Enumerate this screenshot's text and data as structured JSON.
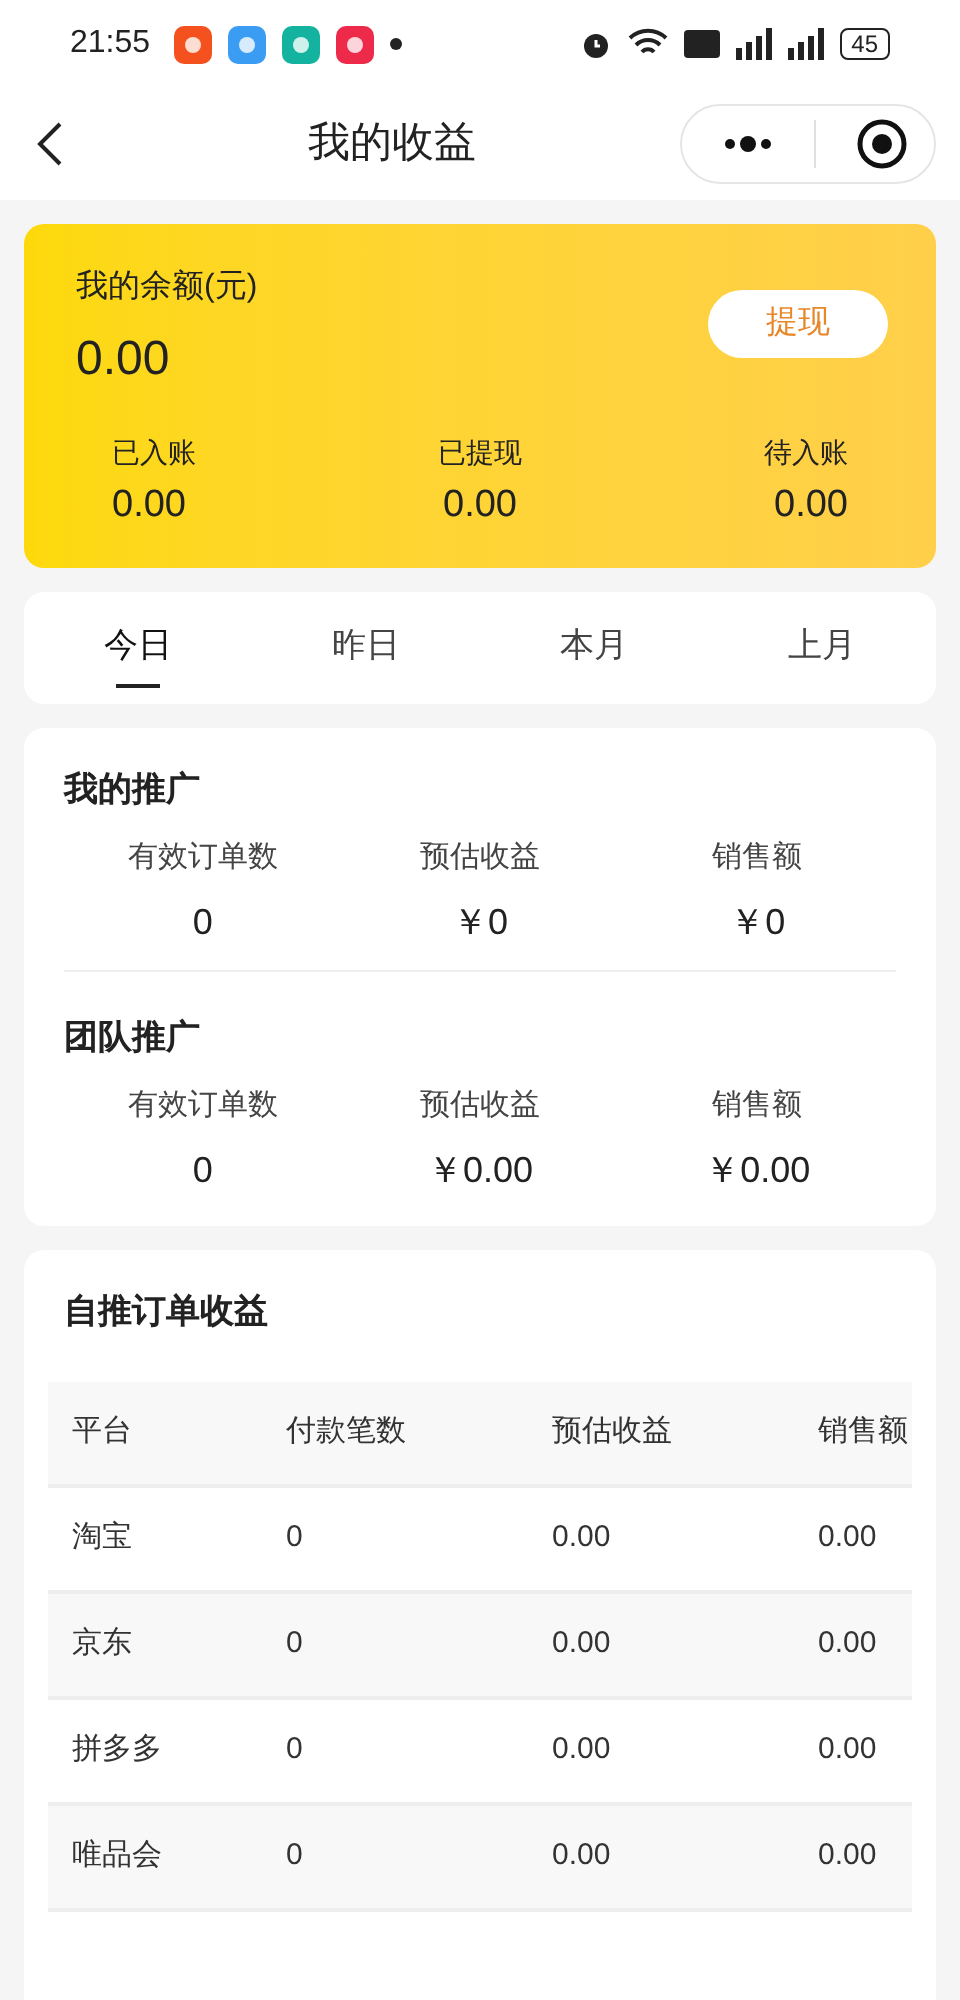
{
  "status_bar": {
    "time": "21:55",
    "battery": "45"
  },
  "header": {
    "title": "我的收益"
  },
  "balance": {
    "label": "我的余额(元)",
    "amount": "0.00",
    "withdraw_button": "提现",
    "stats": [
      {
        "label": "已入账",
        "value": "0.00"
      },
      {
        "label": "已提现",
        "value": "0.00"
      },
      {
        "label": "待入账",
        "value": "0.00"
      }
    ]
  },
  "tabs": [
    {
      "label": "今日",
      "selected": true
    },
    {
      "label": "昨日",
      "selected": false
    },
    {
      "label": "本月",
      "selected": false
    },
    {
      "label": "上月",
      "selected": false
    }
  ],
  "sections": [
    {
      "title": "我的推广",
      "stats": [
        {
          "label": "有效订单数",
          "value": "0"
        },
        {
          "label": "预估收益",
          "value": "￥0"
        },
        {
          "label": "销售额",
          "value": "￥0"
        }
      ]
    },
    {
      "title": "团队推广",
      "stats": [
        {
          "label": "有效订单数",
          "value": "0"
        },
        {
          "label": "预估收益",
          "value": "￥0.00"
        },
        {
          "label": "销售额",
          "value": "￥0.00"
        }
      ]
    }
  ],
  "orders": {
    "title": "自推订单收益",
    "columns": [
      "平台",
      "付款笔数",
      "预估收益",
      "销售额"
    ],
    "rows": [
      [
        "淘宝",
        "0",
        "0.00",
        "0.00"
      ],
      [
        "京东",
        "0",
        "0.00",
        "0.00"
      ],
      [
        "拼多多",
        "0",
        "0.00",
        "0.00"
      ],
      [
        "唯品会",
        "0",
        "0.00",
        "0.00"
      ]
    ]
  }
}
